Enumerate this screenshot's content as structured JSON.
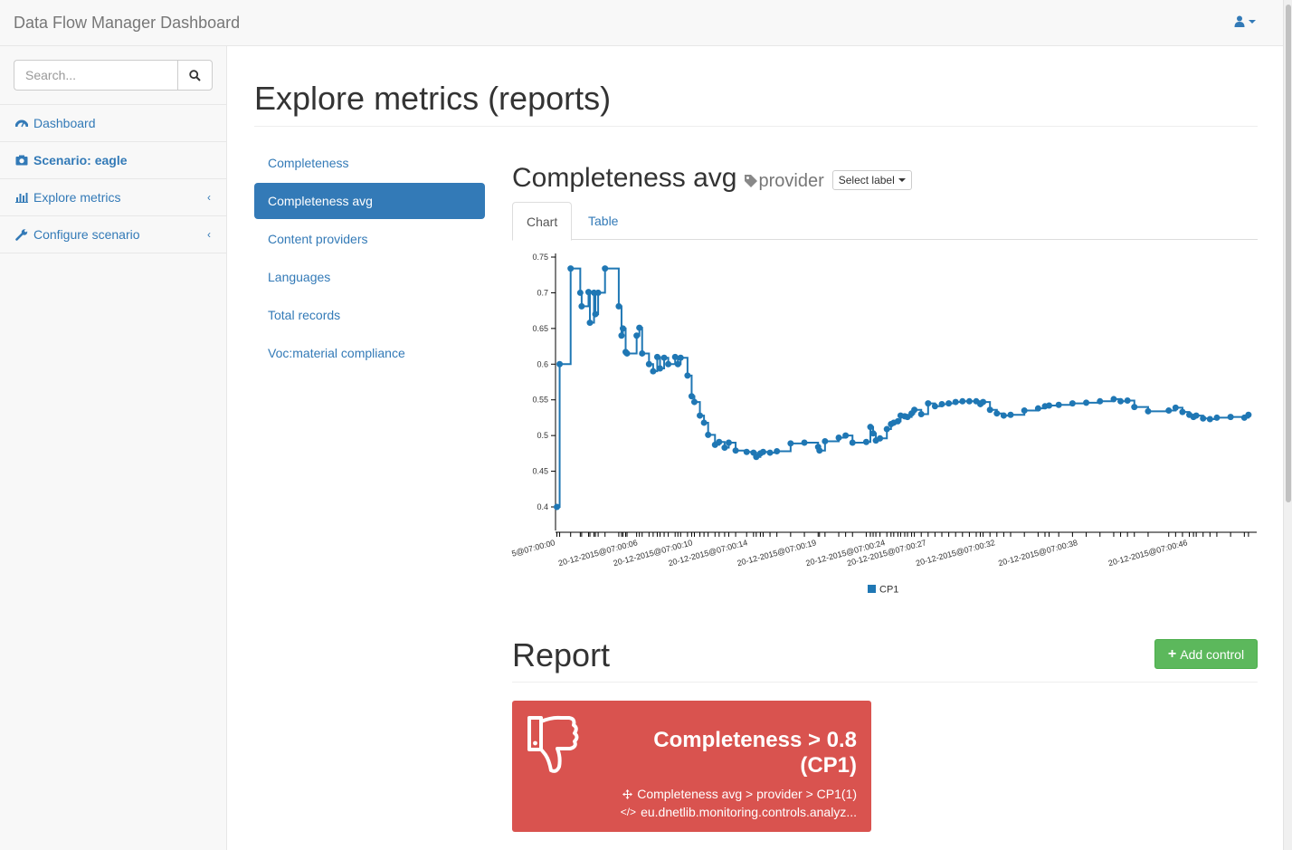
{
  "navbar": {
    "brand": "Data Flow Manager Dashboard"
  },
  "sidebar": {
    "search_placeholder": "Search...",
    "items": [
      {
        "label": "Dashboard",
        "icon": "dashboard-icon"
      },
      {
        "label": "Scenario: eagle",
        "icon": "camera-icon"
      },
      {
        "label": "Explore metrics",
        "icon": "bar-chart-icon"
      },
      {
        "label": "Configure scenario",
        "icon": "wrench-icon"
      }
    ]
  },
  "page": {
    "title": "Explore metrics (reports)"
  },
  "metrics_nav": {
    "items": [
      "Completeness",
      "Completeness avg",
      "Content providers",
      "Languages",
      "Total records",
      "Voc:material compliance"
    ],
    "active": "Completeness avg"
  },
  "section": {
    "title": "Completeness avg",
    "tag": "provider",
    "select_label": "Select label",
    "tabs": [
      "Chart",
      "Table"
    ],
    "active_tab": "Chart"
  },
  "chart_data": {
    "type": "line",
    "interpolation": "step",
    "y_ticks": [
      "0.75",
      "0.7",
      "0.65",
      "0.6",
      "0.55",
      "0.5",
      "0.45",
      "0.4"
    ],
    "ylim": [
      0.4,
      0.75
    ],
    "x_tick_labels": [
      "5@07:00:00",
      "20-12-2015@07:00:06",
      "20-12-2015@07:00:10",
      "20-12-2015@07:00:14",
      "20-12-2015@07:00:19",
      "20-12-2015@07:00:24",
      "20-12-2015@07:00:27",
      "20-12-2015@07:00:32",
      "20-12-2015@07:00:38",
      "20-12-2015@07:00:46"
    ],
    "x_tick_positions": [
      0,
      6,
      10,
      14,
      19,
      24,
      27,
      32,
      38,
      46
    ],
    "xlim": [
      0,
      51
    ],
    "legend": "bottom",
    "series": [
      {
        "name": "CP1",
        "color": "#1f77b4",
        "x": [
          0.1,
          0.3,
          1.1,
          1.8,
          1.9,
          2.4,
          2.5,
          2.8,
          2.9,
          3.1,
          3.6,
          4.6,
          4.8,
          4.9,
          5.1,
          5.2,
          5.9,
          6.1,
          6.3,
          6.8,
          7.1,
          7.4,
          7.6,
          7.9,
          8.2,
          8.7,
          8.9,
          9.1,
          9.6,
          9.9,
          10.1,
          10.5,
          10.8,
          11.1,
          11.6,
          11.9,
          12.3,
          12.6,
          13.1,
          13.9,
          14.4,
          14.6,
          14.9,
          15.1,
          15.6,
          16.1,
          17.1,
          18.1,
          19.1,
          19.2,
          19.6,
          20.6,
          21.1,
          21.6,
          22.6,
          22.9,
          23.1,
          23.3,
          23.6,
          24.1,
          24.4,
          24.6,
          24.9,
          25.1,
          25.4,
          25.6,
          25.9,
          26.1,
          26.6,
          27.1,
          27.6,
          28.1,
          28.6,
          29.1,
          29.6,
          30.1,
          30.6,
          30.9,
          31.1,
          31.6,
          32.1,
          32.6,
          33.1,
          34.1,
          35.1,
          35.6,
          35.9,
          36.6,
          37.6,
          38.6,
          39.6,
          40.6,
          41.1,
          41.6,
          42.1,
          43.1,
          44.6,
          45.1,
          45.6,
          46.1,
          46.4,
          46.6,
          47.1,
          47.6,
          48.1,
          49.1,
          50.1,
          50.4
        ],
        "values": [
          0.4,
          0.6,
          0.734,
          0.7,
          0.681,
          0.701,
          0.658,
          0.7,
          0.67,
          0.7,
          0.734,
          0.681,
          0.64,
          0.65,
          0.617,
          0.615,
          0.64,
          0.651,
          0.615,
          0.6,
          0.59,
          0.61,
          0.594,
          0.609,
          0.6,
          0.61,
          0.6,
          0.609,
          0.584,
          0.555,
          0.547,
          0.528,
          0.518,
          0.501,
          0.487,
          0.491,
          0.483,
          0.49,
          0.479,
          0.477,
          0.476,
          0.47,
          0.475,
          0.477,
          0.476,
          0.478,
          0.489,
          0.49,
          0.484,
          0.479,
          0.492,
          0.497,
          0.5,
          0.49,
          0.491,
          0.512,
          0.503,
          0.493,
          0.496,
          0.509,
          0.516,
          0.518,
          0.52,
          0.528,
          0.527,
          0.526,
          0.531,
          0.536,
          0.53,
          0.545,
          0.541,
          0.544,
          0.545,
          0.547,
          0.548,
          0.548,
          0.548,
          0.544,
          0.547,
          0.536,
          0.531,
          0.528,
          0.529,
          0.535,
          0.538,
          0.541,
          0.542,
          0.543,
          0.545,
          0.546,
          0.548,
          0.551,
          0.548,
          0.549,
          0.54,
          0.534,
          0.535,
          0.539,
          0.533,
          0.529,
          0.526,
          0.528,
          0.524,
          0.523,
          0.525,
          0.526,
          0.525,
          0.529
        ]
      }
    ]
  },
  "report": {
    "title": "Report",
    "add_button": "Add control",
    "card": {
      "title_line1": "Completeness > 0.8",
      "title_line2": "(CP1)",
      "line1": "Completeness avg > provider > CP1(1)",
      "line2": "eu.dnetlib.monitoring.controls.analyz...",
      "color": "#d9534f",
      "icon": "thumbs-down-icon"
    }
  }
}
